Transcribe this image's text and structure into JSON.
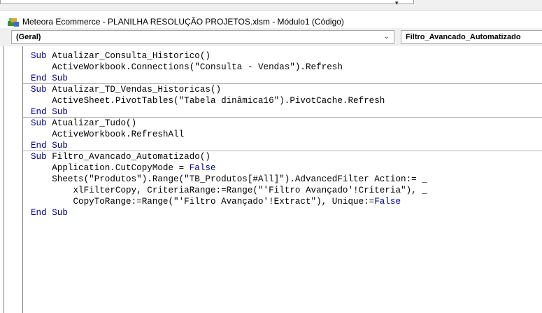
{
  "window": {
    "title": "Meteora Ecommerce - PLANILHA RESOLUÇÃO PROJETOS.xlsm - Módulo1 (Código)"
  },
  "combos": {
    "object": "(Geral)",
    "procedure": "Filtro_Avancado_Automatizado"
  },
  "code": [
    {
      "kw": "Sub",
      "text": " Atualizar_Consulta_Historico()"
    },
    {
      "kw": "",
      "text": "    ActiveWorkbook.Connections(\"Consulta - Vendas\").Refresh"
    },
    {
      "kw": "End Sub",
      "text": ""
    },
    {
      "kw": "Sub",
      "text": " Atualizar_TD_Vendas_Historicas()"
    },
    {
      "kw": "",
      "text": "    ActiveSheet.PivotTables(\"Tabela dinâmica16\").PivotCache.Refresh"
    },
    {
      "kw": "End Sub",
      "text": ""
    },
    {
      "kw": "Sub",
      "text": " Atualizar_Tudo()"
    },
    {
      "kw": "",
      "text": "    ActiveWorkbook.RefreshAll"
    },
    {
      "kw": "End Sub",
      "text": ""
    },
    {
      "kw": "Sub",
      "text": " Filtro_Avancado_Automatizado()"
    },
    {
      "kw": "",
      "text": "    Application.CutCopyMode = ",
      "kw2": "False"
    },
    {
      "kw": "",
      "text": "    Sheets(\"Produtos\").Range(\"TB_Produtos[#All]\").AdvancedFilter Action:= _"
    },
    {
      "kw": "",
      "text": "        xlFilterCopy, CriteriaRange:=Range(\"'Filtro Avançado'!Criteria\"), _"
    },
    {
      "kw": "",
      "text": "        CopyToRange:=Range(\"'Filtro Avançado'!Extract\"), Unique:=",
      "kw2": "False"
    },
    {
      "kw": "End Sub",
      "text": ""
    }
  ]
}
